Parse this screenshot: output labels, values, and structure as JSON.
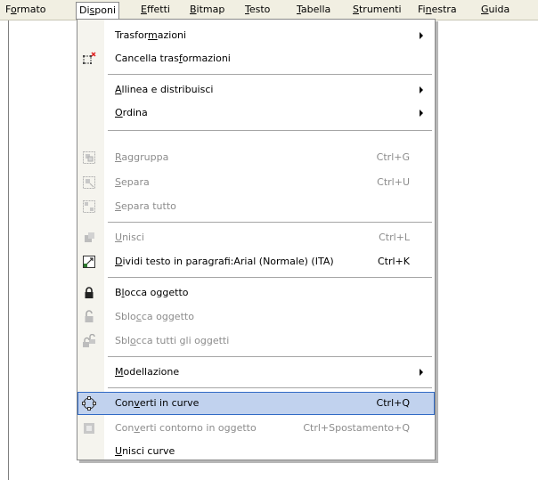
{
  "menubar": {
    "items": [
      {
        "label": "Formato",
        "mnemonic": "o"
      },
      {
        "label": "Disponi",
        "mnemonic": "s"
      },
      {
        "label": "Effetti",
        "mnemonic": "E"
      },
      {
        "label": "Bitmap",
        "mnemonic": "B"
      },
      {
        "label": "Testo",
        "mnemonic": "T"
      },
      {
        "label": "Tabella",
        "mnemonic": "T"
      },
      {
        "label": "Strumenti",
        "mnemonic": "S"
      },
      {
        "label": "Finestra",
        "mnemonic": "n"
      },
      {
        "label": "Guida",
        "mnemonic": "G"
      }
    ],
    "active_index": 1
  },
  "dropdown": {
    "items": [
      {
        "label": "Trasformazioni",
        "mnemonic": "m",
        "submenu": true,
        "enabled": true,
        "icon": ""
      },
      {
        "label": "Cancella trasformazioni",
        "mnemonic": "f",
        "enabled": true,
        "icon": "clear-transform-icon"
      },
      {
        "label": "Allinea e distribuisci",
        "mnemonic": "A",
        "submenu": true,
        "enabled": true,
        "icon": ""
      },
      {
        "label": "Ordina",
        "mnemonic": "O",
        "submenu": true,
        "enabled": true,
        "icon": ""
      },
      {
        "label": "Raggruppa",
        "mnemonic": "R",
        "shortcut": "Ctrl+G",
        "enabled": false,
        "icon": "group-icon"
      },
      {
        "label": "Separa",
        "mnemonic": "S",
        "shortcut": "Ctrl+U",
        "enabled": false,
        "icon": "ungroup-icon"
      },
      {
        "label": "Separa tutto",
        "mnemonic": "S",
        "enabled": false,
        "icon": "ungroup-all-icon"
      },
      {
        "label": "Unisci",
        "mnemonic": "U",
        "shortcut": "Ctrl+L",
        "enabled": false,
        "icon": "combine-icon"
      },
      {
        "label": "Dividi testo in paragrafi:Arial (Normale) (ITA)",
        "mnemonic": "D",
        "shortcut": "Ctrl+K",
        "enabled": true,
        "icon": "break-apart-icon"
      },
      {
        "label": "Blocca oggetto",
        "mnemonic": "l",
        "enabled": true,
        "icon": "lock-icon"
      },
      {
        "label": "Sblocca oggetto",
        "mnemonic": "c",
        "enabled": false,
        "icon": "unlock-icon"
      },
      {
        "label": "Sblocca tutti gli oggetti",
        "mnemonic": "o",
        "enabled": false,
        "icon": "unlock-all-icon"
      },
      {
        "label": "Modellazione",
        "mnemonic": "M",
        "submenu": true,
        "enabled": true,
        "icon": ""
      },
      {
        "label": "Converti in curve",
        "mnemonic": "v",
        "shortcut": "Ctrl+Q",
        "enabled": true,
        "highlighted": true,
        "icon": "convert-to-curves-icon"
      },
      {
        "label": "Converti contorno in oggetto",
        "mnemonic": "v",
        "shortcut": "Ctrl+Spostamento+Q",
        "enabled": false,
        "icon": "outline-to-object-icon"
      },
      {
        "label": "Unisci curve",
        "mnemonic": "U",
        "enabled": true,
        "icon": ""
      }
    ]
  },
  "colors": {
    "menubar_bg": "#f1efe2",
    "highlight_bg": "#c1d2ee",
    "highlight_border": "#316ac5",
    "disabled_text": "#8c8c8c"
  }
}
